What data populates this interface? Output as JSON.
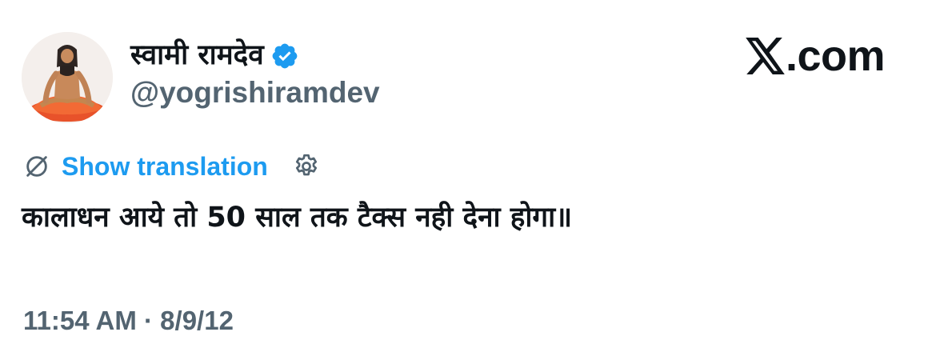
{
  "tweet": {
    "author": {
      "display_name": "स्वामी रामदेव",
      "handle": "@yogrishiramdev",
      "avatar_icon": "person-meditating-avatar",
      "verified_icon": "verified-badge-icon"
    },
    "brand": {
      "icon": "x-logo-icon",
      "text": ".com"
    },
    "translation": {
      "icon": "translate-icon",
      "label": "Show translation",
      "settings_icon": "gear-icon"
    },
    "text": "कालाधन आये तो 50 साल तक टैक्स नही देना होगा॥",
    "timestamp": "11:54 AM · 8/9/12"
  },
  "colors": {
    "text_primary": "#0f1419",
    "text_secondary": "#536471",
    "accent": "#1d9bf0",
    "verified": "#1d9bf0",
    "background": "#ffffff"
  }
}
